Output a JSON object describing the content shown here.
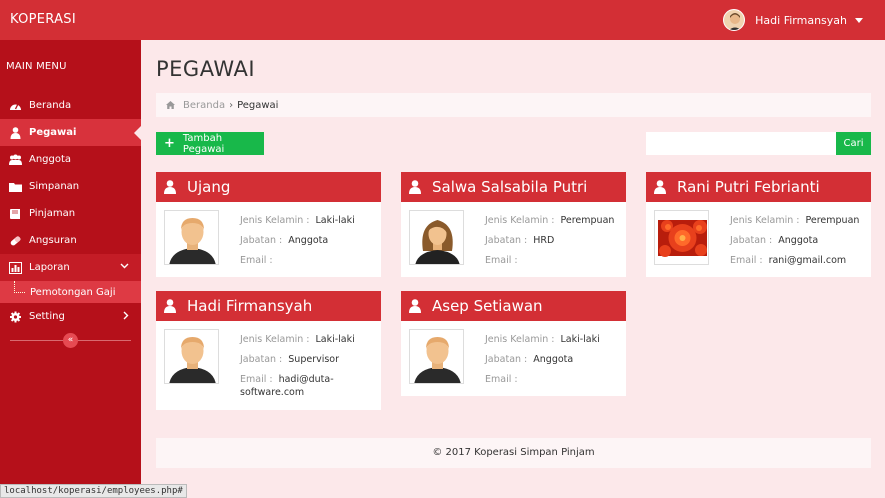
{
  "app": {
    "brand": "KOPERASI"
  },
  "user": {
    "name": "Hadi Firmansyah"
  },
  "sidebar": {
    "header": "MAIN MENU",
    "items": [
      {
        "label": "Beranda",
        "icon": "dashboard-icon"
      },
      {
        "label": "Pegawai",
        "icon": "user-icon"
      },
      {
        "label": "Anggota",
        "icon": "users-icon"
      },
      {
        "label": "Simpanan",
        "icon": "folder-icon"
      },
      {
        "label": "Pinjaman",
        "icon": "book-icon"
      },
      {
        "label": "Angsuran",
        "icon": "pill-icon"
      },
      {
        "label": "Laporan",
        "icon": "bar-chart-icon"
      },
      {
        "label": "Setting",
        "icon": "gear-icon"
      }
    ],
    "submenu": [
      "Pemotongan Gaji"
    ],
    "collapse_symbol": "«"
  },
  "page": {
    "title": "PEGAWAI"
  },
  "breadcrumb": {
    "home": "Beranda",
    "sep": "›",
    "current": "Pegawai"
  },
  "toolbar": {
    "add_label": "Tambah Pegawai",
    "search_label": "Cari",
    "search_placeholder": ""
  },
  "labels": {
    "gender": "Jenis Kelamin :",
    "position": "Jabatan :",
    "email": "Email :"
  },
  "employees": [
    {
      "name": "Ujang",
      "gender": "Laki-laki",
      "position": "Anggota",
      "email": "",
      "photo": "male"
    },
    {
      "name": "Salwa Salsabila Putri",
      "gender": "Perempuan",
      "position": "HRD",
      "email": "",
      "photo": "female"
    },
    {
      "name": "Rani Putri Febrianti",
      "gender": "Perempuan",
      "position": "Anggota",
      "email": "rani@gmail.com",
      "photo": "flower"
    },
    {
      "name": "Hadi Firmansyah",
      "gender": "Laki-laki",
      "position": "Supervisor",
      "email": "hadi@duta-software.com",
      "photo": "male"
    },
    {
      "name": "Asep Setiawan",
      "gender": "Laki-laki",
      "position": "Anggota",
      "email": "",
      "photo": "male"
    }
  ],
  "footer": {
    "text": "© 2017 Koperasi Simpan Pinjam"
  },
  "status_url": "localhost/koperasi/employees.php#",
  "colors": {
    "primary": "#d32f35",
    "sidebar": "#b5101a",
    "success": "#18b84a",
    "background": "#fce8ea"
  }
}
